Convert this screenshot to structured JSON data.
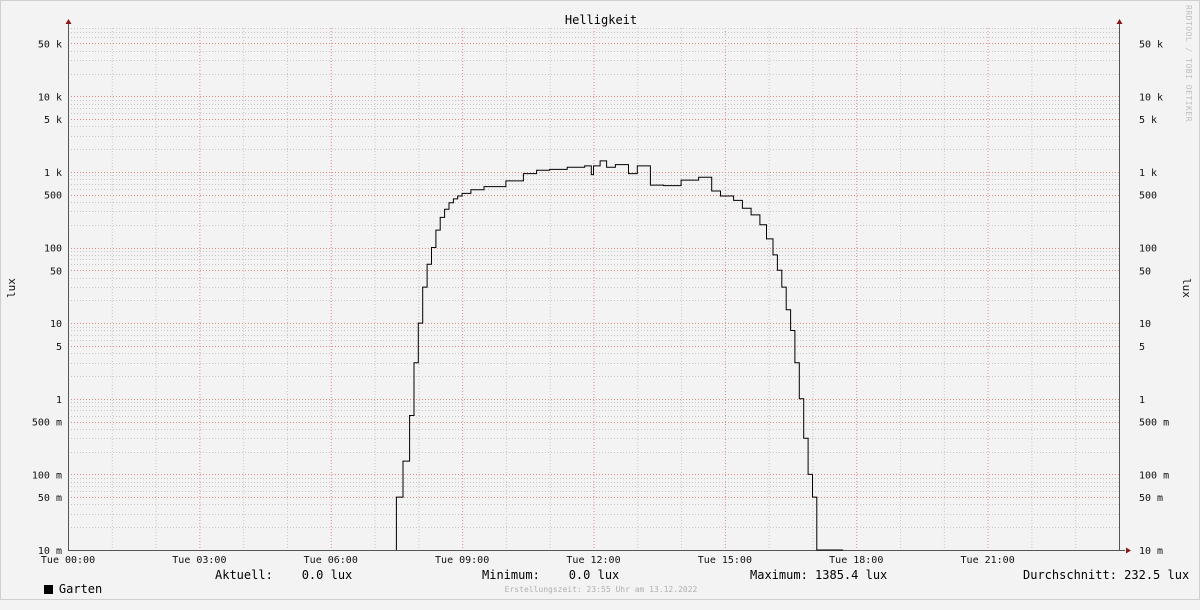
{
  "chart_data": {
    "type": "line",
    "title": "Helligkeit",
    "ylabel": "lux",
    "yscale": "log",
    "ylim": [
      0.01,
      80000
    ],
    "xlim_hours": [
      0,
      24
    ],
    "x_tick_labels": [
      "Tue 00:00",
      "Tue 03:00",
      "Tue 06:00",
      "Tue 09:00",
      "Tue 12:00",
      "Tue 15:00",
      "Tue 18:00",
      "Tue 21:00"
    ],
    "y_ticks": [
      {
        "value": 50000,
        "label": "50 k"
      },
      {
        "value": 10000,
        "label": "10 k"
      },
      {
        "value": 5000,
        "label": "5 k"
      },
      {
        "value": 1000,
        "label": "1 k"
      },
      {
        "value": 500,
        "label": "500"
      },
      {
        "value": 100,
        "label": "100"
      },
      {
        "value": 50,
        "label": "50"
      },
      {
        "value": 10,
        "label": "10"
      },
      {
        "value": 5,
        "label": "5"
      },
      {
        "value": 1,
        "label": "1"
      },
      {
        "value": 0.5,
        "label": "500 m"
      },
      {
        "value": 0.1,
        "label": "100 m"
      },
      {
        "value": 0.05,
        "label": "50 m"
      },
      {
        "value": 0.01,
        "label": "10 m"
      }
    ],
    "grid": true,
    "series": [
      {
        "name": "Garten",
        "color": "#000000",
        "x": [
          7.5,
          7.65,
          7.8,
          7.9,
          8.0,
          8.1,
          8.2,
          8.3,
          8.4,
          8.5,
          8.6,
          8.7,
          8.8,
          8.9,
          9.0,
          9.2,
          9.5,
          10.0,
          10.4,
          10.7,
          11.0,
          11.4,
          11.8,
          11.95,
          12.0,
          12.15,
          12.3,
          12.5,
          12.8,
          13.0,
          13.3,
          13.6,
          14.0,
          14.4,
          14.7,
          14.9,
          15.2,
          15.4,
          15.6,
          15.8,
          15.95,
          16.1,
          16.2,
          16.3,
          16.4,
          16.5,
          16.6,
          16.7,
          16.8,
          16.9,
          17.0,
          17.1,
          17.2,
          17.3,
          17.4,
          17.5,
          17.6,
          17.7
        ],
        "y": [
          0.05,
          0.15,
          0.6,
          3,
          10,
          30,
          60,
          100,
          170,
          250,
          320,
          390,
          440,
          480,
          520,
          580,
          640,
          760,
          950,
          1050,
          1080,
          1150,
          1200,
          920,
          1200,
          1400,
          1150,
          1250,
          950,
          1200,
          670,
          660,
          780,
          850,
          560,
          480,
          420,
          330,
          270,
          200,
          130,
          80,
          50,
          30,
          15,
          8,
          3,
          1,
          0.3,
          0.1,
          0.05,
          0.01,
          0.01,
          0.01,
          0.01,
          0.01,
          0.01,
          0.01
        ]
      }
    ]
  },
  "legend": {
    "series_label": "Garten",
    "aktuell": "Aktuell:    0.0 lux",
    "minimum": "Minimum:    0.0 lux",
    "maximum": "Maximum: 1385.4 lux",
    "durchschnitt": "Durchschnitt: 232.5 lux"
  },
  "footer": "Erstellungszeit: 23:55 Uhr am 13.12.2022",
  "watermark": "RRDTOOL / TOBI OETIKER",
  "colors": {
    "background": "#f3f3f3",
    "grid_major": "#e08a8a",
    "grid_minor": "#c8c8c8",
    "axis": "#8a1a1a",
    "line": "#000000"
  }
}
